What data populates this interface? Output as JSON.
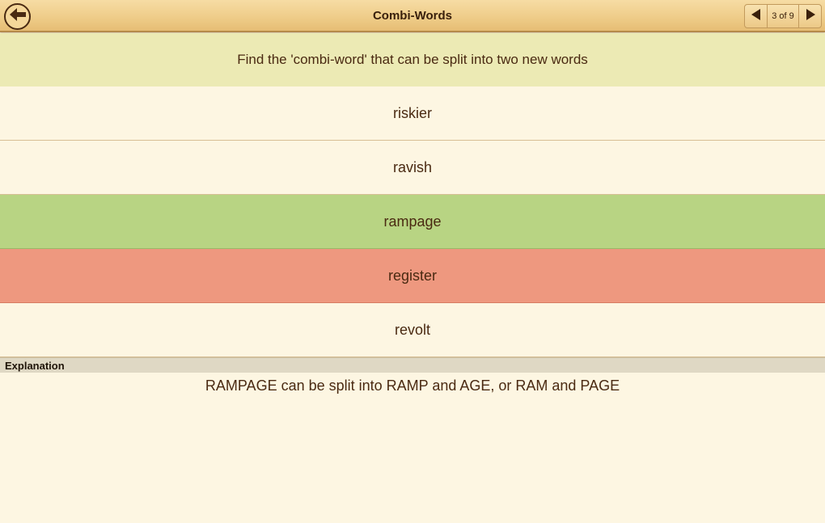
{
  "header": {
    "title": "Combi-Words",
    "back_icon": "arrow-left-icon",
    "pager": {
      "current": 3,
      "total": 9,
      "label": "3 of 9"
    }
  },
  "question": {
    "text": "Find the 'combi-word' that can be split into two new words"
  },
  "options": [
    {
      "label": "riskier",
      "state": "plain"
    },
    {
      "label": "ravish",
      "state": "plain"
    },
    {
      "label": "rampage",
      "state": "correct"
    },
    {
      "label": "register",
      "state": "wrong"
    },
    {
      "label": "revolt",
      "state": "plain"
    }
  ],
  "explanation": {
    "heading": "Explanation",
    "text": "RAMPAGE can be split into RAMP and AGE, or RAM and PAGE"
  },
  "colors": {
    "correct": "#b8d483",
    "wrong": "#ee987f",
    "question_bg": "#eceab4",
    "page_bg": "#fdf6e2"
  }
}
